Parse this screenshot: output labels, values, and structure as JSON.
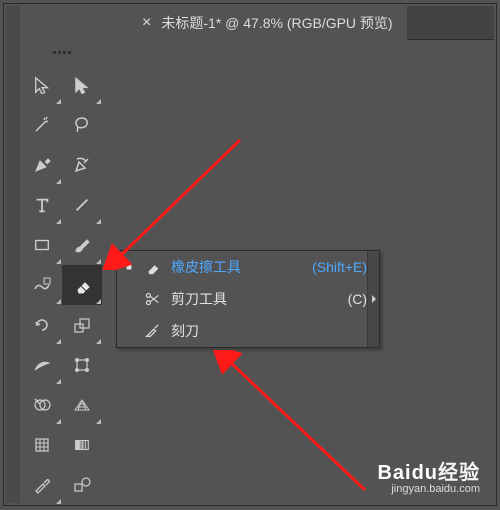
{
  "tab": {
    "close_glyph": "×",
    "title": "未标题-1* @ 47.8% (RGB/GPU 预览)"
  },
  "tools": {
    "row0": [
      "selection-tool",
      "direct-selection-tool"
    ],
    "row1": [
      "magic-wand-tool",
      "lasso-tool"
    ],
    "row2": [
      "pen-tool",
      "curvature-tool"
    ],
    "row3": [
      "type-tool",
      "line-segment-tool"
    ],
    "row4": [
      "rectangle-tool",
      "paintbrush-tool"
    ],
    "row5": [
      "shaper-tool",
      "eraser-tool"
    ],
    "row6": [
      "rotate-tool",
      "scale-tool"
    ],
    "row7": [
      "width-tool",
      "free-transform-tool"
    ],
    "row8": [
      "shape-builder-tool",
      "perspective-grid-tool"
    ],
    "row9": [
      "mesh-tool",
      "gradient-tool"
    ],
    "row10": [
      "eyedropper-tool",
      "blend-tool"
    ]
  },
  "flyout": {
    "items": [
      {
        "label": "橡皮擦工具",
        "shortcut": "(Shift+E)",
        "selected": true
      },
      {
        "label": "剪刀工具",
        "shortcut": "(C)",
        "selected": false
      },
      {
        "label": "刻刀",
        "shortcut": "",
        "selected": false
      }
    ]
  },
  "watermark": {
    "brand_a": "Bai",
    "brand_b": "du",
    "brand_c": "经验",
    "url": "jingyan.baidu.com"
  }
}
